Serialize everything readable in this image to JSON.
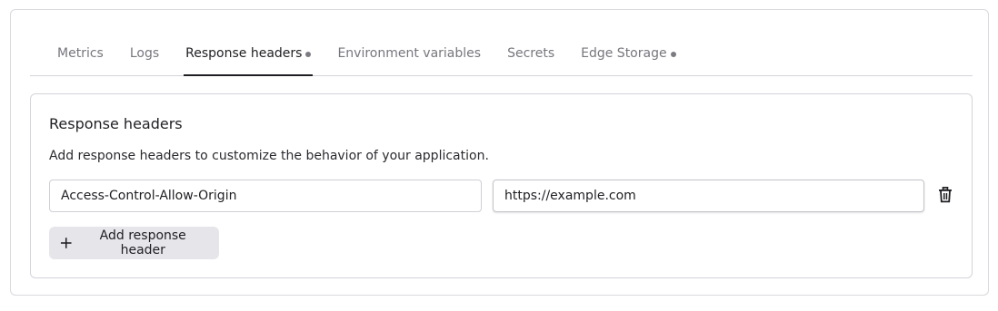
{
  "tabs": [
    {
      "label": "Metrics",
      "active": false,
      "dot": false
    },
    {
      "label": "Logs",
      "active": false,
      "dot": false
    },
    {
      "label": "Response headers",
      "active": true,
      "dot": true
    },
    {
      "label": "Environment variables",
      "active": false,
      "dot": false
    },
    {
      "label": "Secrets",
      "active": false,
      "dot": false
    },
    {
      "label": "Edge Storage",
      "active": false,
      "dot": true
    }
  ],
  "panel": {
    "title": "Response headers",
    "description": "Add response headers to customize the behavior of your application.",
    "rows": [
      {
        "name": "Access-Control-Allow-Origin",
        "value": "https://example.com",
        "delete_icon": "trash-icon"
      }
    ],
    "add_button_label": "Add response header",
    "add_button_icon": "plus-icon"
  },
  "colors": {
    "active_tab_underline": "#1f1f23",
    "button_bg": "#e6e5ea",
    "border": "#d4d4da"
  }
}
